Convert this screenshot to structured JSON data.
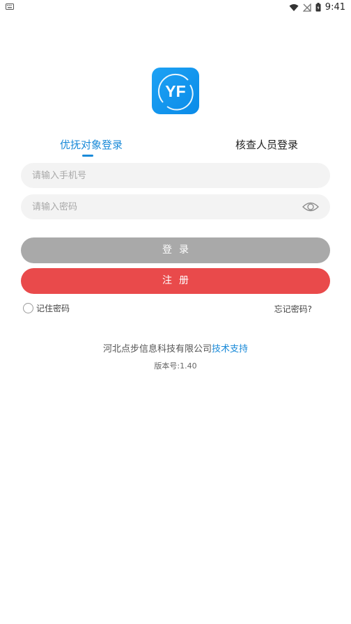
{
  "status_bar": {
    "time": "9:41"
  },
  "app": {
    "logo_text": "YF"
  },
  "tabs": [
    {
      "label": "优抚对象登录",
      "active": true
    },
    {
      "label": "核查人员登录",
      "active": false
    }
  ],
  "form": {
    "phone_placeholder": "请输入手机号",
    "password_placeholder": "请输入密码"
  },
  "buttons": {
    "login": "登录",
    "register": "注册"
  },
  "options": {
    "remember_password": "记住密码",
    "forgot_password": "忘记密码?"
  },
  "footer": {
    "company": "河北点步信息科技有限公司",
    "support": "技术支持",
    "version": "版本号:1.40"
  },
  "colors": {
    "accent": "#1a8ad8",
    "register": "#e94a4b",
    "login_disabled": "#a9a9a9"
  }
}
